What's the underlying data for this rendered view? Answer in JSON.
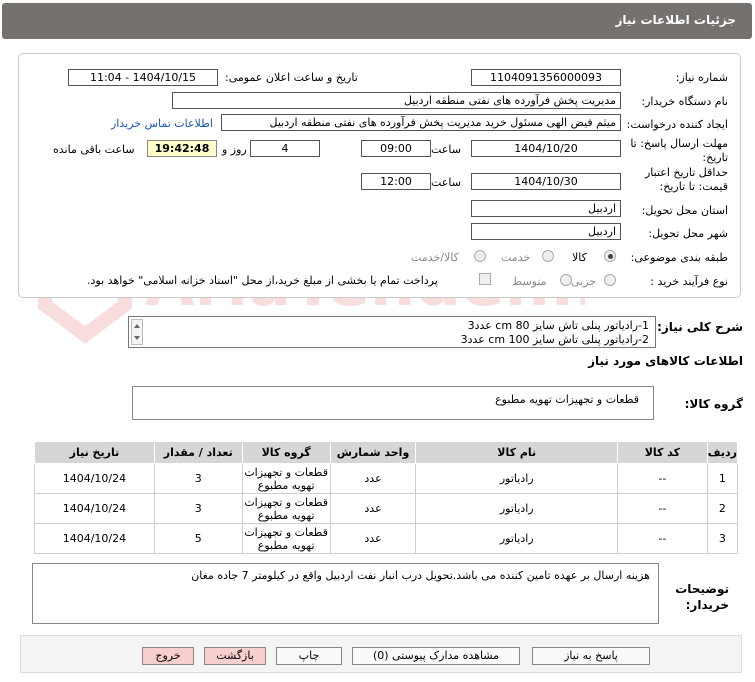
{
  "header": {
    "title": "جزئیات اطلاعات نیاز"
  },
  "form": {
    "need_number_label": "شماره نیاز:",
    "need_number": "1104091356000093",
    "announce_label": "تاریخ و ساعت اعلان عمومی:",
    "announce_value": "1404/10/15 - 11:04",
    "buyer_label": "نام دستگاه خریدار:",
    "buyer_value": "مدیریت پخش فرآورده های نفتی منطقه اردبیل",
    "requester_label": "ایجاد کننده درخواست:",
    "requester_value": "میثم فیض الهی مسئول خرید مدیریت پخش فرآورده های نفتی منطقه اردبیل",
    "contact_link": "اطلاعات تماس خریدار",
    "deadline_label": "مهلت ارسال پاسخ: تا",
    "deadline_label2": "تاریخ:",
    "deadline_date": "1404/10/20",
    "time_label": "ساعت",
    "deadline_time": "09:00",
    "days_value": "4",
    "days_label": "روز و",
    "remaining_time": "19:42:48",
    "remaining_label": "ساعت باقی مانده",
    "validity_label": "حداقل تاریخ اعتبار",
    "validity_label2": "قیمت: تا تاریخ:",
    "validity_date": "1404/10/30",
    "validity_time": "12:00",
    "province_label": "استان محل تحویل:",
    "province_value": "اردبیل",
    "city_label": "شهر محل تحویل:",
    "city_value": "اردبیل",
    "category_label": "طبقه بندی موضوعی:",
    "category_options": [
      "کالا",
      "خدمت",
      "کالا/خدمت"
    ],
    "process_label": "نوع فرآیند خرید :",
    "process_options": [
      "جزیی",
      "متوسط"
    ],
    "process_note": "پرداخت تمام یا بخشی از مبلغ خرید،از محل \"اسناد خزانه اسلامی\" خواهد بود."
  },
  "description": {
    "label": "شرح کلی نیاز:",
    "lines": [
      "1-رادیاتور پنلی تاش سایز 80 cm  عدد3",
      "2-رادیاتور پنلی تاش سایز 100 cm عدد3"
    ]
  },
  "goods": {
    "section_title": "اطلاعات کالاهای مورد نیاز",
    "group_label": "گروه کالا:",
    "group_value": "قطعات و تجهیزات تهویه مطبوع"
  },
  "table": {
    "headers": [
      "ردیف",
      "کد کالا",
      "نام کالا",
      "واحد شمارش",
      "گروه کالا",
      "تعداد / مقدار",
      "تاریخ نیاز"
    ],
    "rows": [
      {
        "idx": "1",
        "code": "--",
        "name": "رادیاتور",
        "unit": "عدد",
        "group1": "قطعات و تجهیزات",
        "group2": "تهویه مطبوع",
        "qty": "3",
        "date": "1404/10/24"
      },
      {
        "idx": "2",
        "code": "--",
        "name": "رادیاتور",
        "unit": "عدد",
        "group1": "قطعات و تجهیزات",
        "group2": "تهویه مطبوع",
        "qty": "3",
        "date": "1404/10/24"
      },
      {
        "idx": "3",
        "code": "--",
        "name": "رادیاتور",
        "unit": "عدد",
        "group1": "قطعات و تجهیزات",
        "group2": "تهویه مطبوع",
        "qty": "5",
        "date": "1404/10/24"
      }
    ]
  },
  "notes": {
    "label1": "توضیحات",
    "label2": "خریدار:",
    "text": "هزینه ارسال بر عهده تامین کننده می باشد.تحویل درب انبار نفت اردبیل واقع در کیلومتر 7 جاده مغان"
  },
  "buttons": {
    "reply": "پاسخ به نیاز",
    "attachments": "مشاهده مدارک پیوستی (0)",
    "print": "چاپ",
    "back": "بازگشت",
    "exit": "خروج"
  },
  "watermark": {
    "text": "AriaTender.neT"
  },
  "colors": {
    "header_bg": "#75716f",
    "link": "#1a56b8",
    "time_bg": "#ffffcc",
    "table_head": "#d6d6d6"
  }
}
